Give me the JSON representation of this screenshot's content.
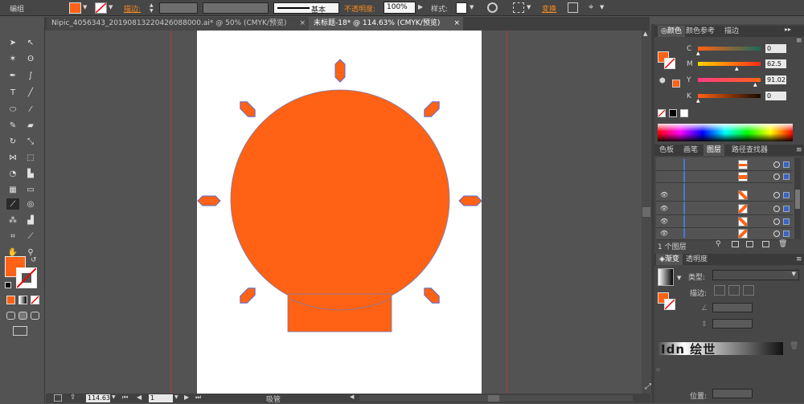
{
  "control_bar": {
    "selection_label": "编组",
    "stroke_label": "描边:",
    "stroke_style": "基本",
    "opacity_label": "不透明度:",
    "opacity_value": "100%",
    "style_label": "样式:",
    "transform_label": "变换"
  },
  "tabs": [
    {
      "label": "Nipic_4056343_20190813220426088000.ai* @ 50% (CMYK/预览)",
      "close": "×"
    },
    {
      "label": "未标题-18* @ 114.63% (CMYK/预览)",
      "close": "×"
    }
  ],
  "status_bar": {
    "zoom": "114.63",
    "page": "1",
    "tool_name": "吸管"
  },
  "color_panel": {
    "tabs": [
      "颜色",
      "颜色参考",
      "描边"
    ],
    "channels": [
      {
        "name": "C",
        "value": "0"
      },
      {
        "name": "M",
        "value": "62.5"
      },
      {
        "name": "Y",
        "value": "91.02"
      },
      {
        "name": "K",
        "value": "0"
      }
    ]
  },
  "layers_panel": {
    "tabs": [
      "色板",
      "画笔",
      "图层",
      "路径查找器"
    ],
    "footer": "1 个图层"
  },
  "gradient_panel": {
    "tabs": [
      "渐变",
      "透明度"
    ],
    "type_label": "类型:",
    "stroke_label": "描边:",
    "position_label": "位置:"
  },
  "watermark": "Idn 绘世",
  "colors": {
    "fill": "#ff6214",
    "app_bg": "#535353",
    "panel_bg": "#464646",
    "accent_orange": "#f7891f"
  }
}
